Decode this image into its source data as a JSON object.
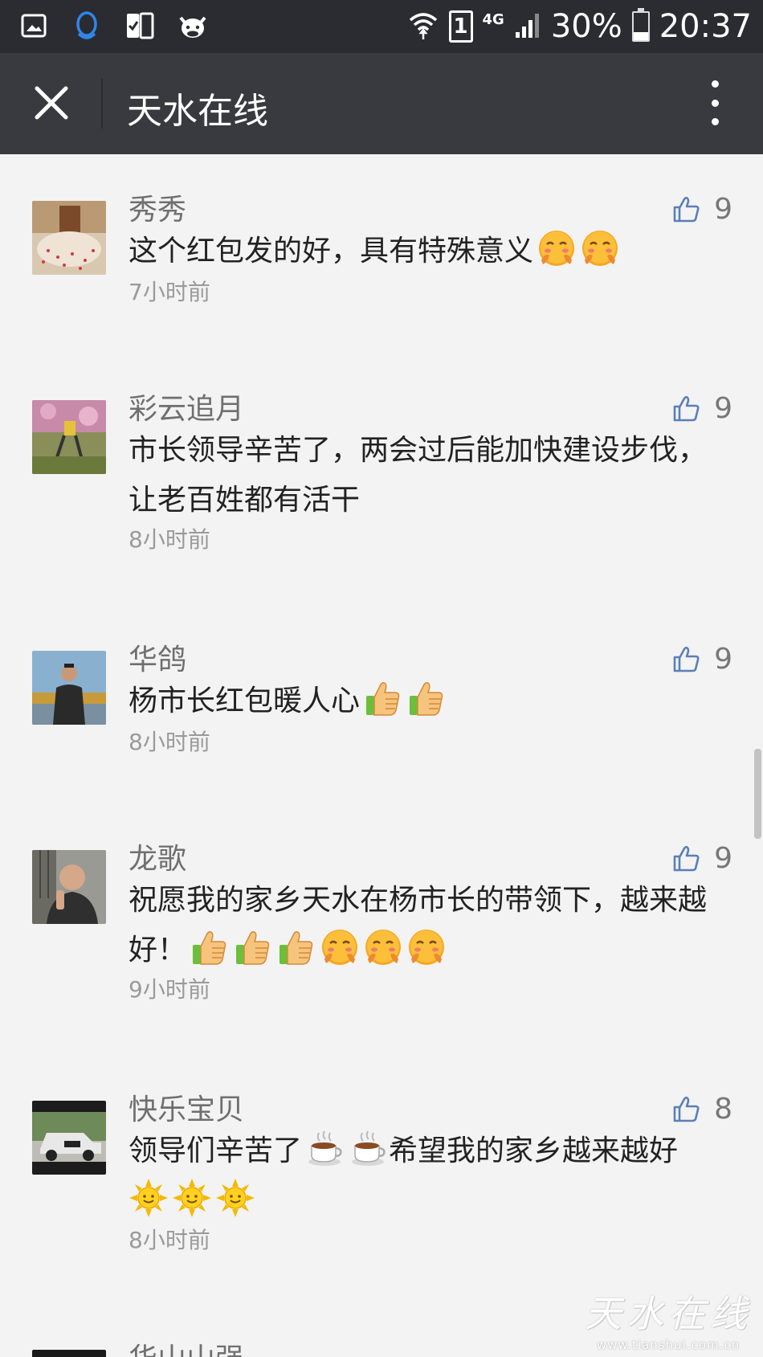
{
  "status_bar": {
    "sim_label": "1",
    "network": "4G",
    "battery": "30%",
    "battery_level": 0.3,
    "time": "20:37",
    "icons": [
      "gallery-icon",
      "qq-icon",
      "sim-toolkit-icon",
      "cow-icon",
      "wifi-icon",
      "signal-icon",
      "battery-icon"
    ]
  },
  "nav": {
    "title": "天水在线",
    "close_icon": "close-icon",
    "more_icon": "more-vertical-icon"
  },
  "comments": [
    {
      "name": "秀秀",
      "text": "这个红包发的好，具有特殊意义",
      "emojis": [
        "blush-emoji",
        "blush-emoji"
      ],
      "time": "7小时前",
      "likes": "9"
    },
    {
      "name": "彩云追月",
      "text": "市长领导辛苦了，两会过后能加快建设步伐，让老百姓都有活干",
      "emojis": [],
      "time": "8小时前",
      "likes": "9"
    },
    {
      "name": "华鸽",
      "text": "杨市长红包暖人心",
      "emojis": [
        "thumbs-up-emoji",
        "thumbs-up-emoji"
      ],
      "time": "8小时前",
      "likes": "9"
    },
    {
      "name": "龙歌",
      "text": "祝愿我的家乡天水在杨市长的带领下，越来越好！",
      "emojis": [
        "thumbs-up-emoji",
        "thumbs-up-emoji",
        "thumbs-up-emoji",
        "blush-emoji",
        "blush-emoji",
        "blush-emoji"
      ],
      "time": "9小时前",
      "likes": "9"
    },
    {
      "name": "快乐宝贝",
      "text_a": "领导们辛苦了",
      "text_b": "希望我的家乡越来越好",
      "emojis_a": [
        "coffee-emoji",
        "coffee-emoji"
      ],
      "emojis_b": [
        "sun-emoji",
        "sun-emoji",
        "sun-emoji"
      ],
      "time": "8小时前",
      "likes": "8"
    },
    {
      "name": "华山山强"
    }
  ],
  "watermark": {
    "title": "天水在线",
    "url": "www.tianshui.com.cn"
  },
  "colors": {
    "status_bar": "#2a2c31",
    "nav_bar": "#393a3f",
    "background": "#f3f3f3",
    "like_icon": "#5b7fb8"
  }
}
